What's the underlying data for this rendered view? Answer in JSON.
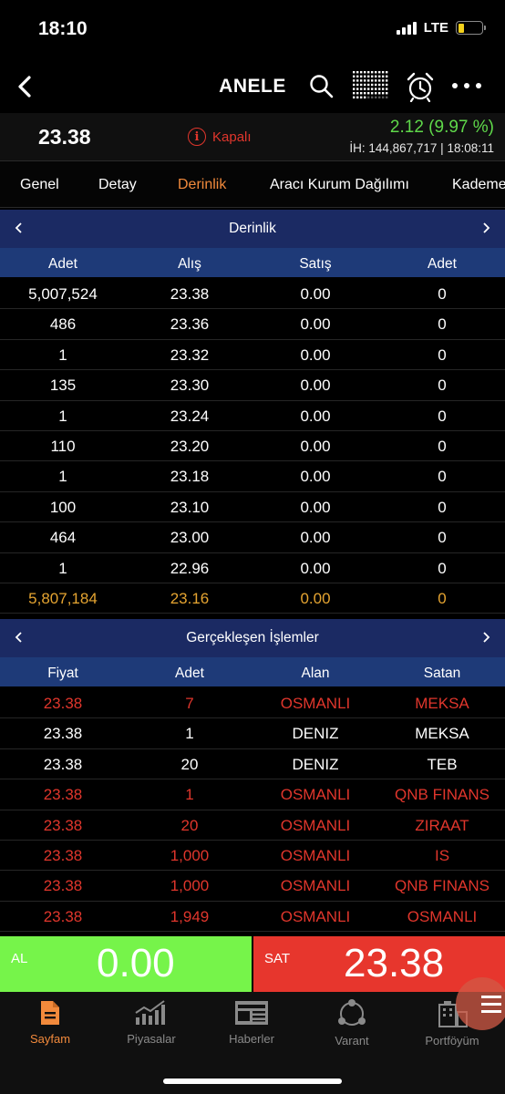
{
  "status": {
    "time": "18:10",
    "network": "LTE"
  },
  "nav": {
    "title": "ANELE"
  },
  "price": {
    "last": "23.38",
    "state": "Kapalı",
    "change": "2.12 (9.97 %)",
    "volume": "İH:  144,867,717 | 18:08:11"
  },
  "tabs": [
    {
      "label": "Genel"
    },
    {
      "label": "Detay"
    },
    {
      "label": "Derinlik"
    },
    {
      "label": "Aracı Kurum Dağılımı"
    },
    {
      "label": "Kademe"
    }
  ],
  "depth": {
    "title": "Derinlik",
    "columns": [
      "Adet",
      "Alış",
      "Satış",
      "Adet"
    ],
    "rows": [
      [
        "5,007,524",
        "23.38",
        "0.00",
        "0"
      ],
      [
        "486",
        "23.36",
        "0.00",
        "0"
      ],
      [
        "1",
        "23.32",
        "0.00",
        "0"
      ],
      [
        "135",
        "23.30",
        "0.00",
        "0"
      ],
      [
        "1",
        "23.24",
        "0.00",
        "0"
      ],
      [
        "110",
        "23.20",
        "0.00",
        "0"
      ],
      [
        "1",
        "23.18",
        "0.00",
        "0"
      ],
      [
        "100",
        "23.10",
        "0.00",
        "0"
      ],
      [
        "464",
        "23.00",
        "0.00",
        "0"
      ],
      [
        "1",
        "22.96",
        "0.00",
        "0"
      ]
    ],
    "total": [
      "5,807,184",
      "23.16",
      "0.00",
      "0"
    ]
  },
  "trades": {
    "title": "Gerçekleşen İşlemler",
    "columns": [
      "Fiyat",
      "Adet",
      "Alan",
      "Satan"
    ],
    "rows": [
      {
        "cells": [
          "23.38",
          "7",
          "OSMANLI",
          "MEKSA"
        ],
        "color": "red"
      },
      {
        "cells": [
          "23.38",
          "1",
          "DENIZ",
          "MEKSA"
        ],
        "color": "white"
      },
      {
        "cells": [
          "23.38",
          "20",
          "DENIZ",
          "TEB"
        ],
        "color": "white"
      },
      {
        "cells": [
          "23.38",
          "1",
          "OSMANLI",
          "QNB FINANS"
        ],
        "color": "red"
      },
      {
        "cells": [
          "23.38",
          "20",
          "OSMANLI",
          "ZIRAAT"
        ],
        "color": "red"
      },
      {
        "cells": [
          "23.38",
          "1,000",
          "OSMANLI",
          "IS"
        ],
        "color": "red"
      },
      {
        "cells": [
          "23.38",
          "1,000",
          "OSMANLI",
          "QNB FINANS"
        ],
        "color": "red"
      },
      {
        "cells": [
          "23.38",
          "1,949",
          "OSMANLI",
          "OSMANLI"
        ],
        "color": "red"
      }
    ]
  },
  "trade": {
    "buy_label": "AL",
    "buy_value": "0.00",
    "sell_label": "SAT",
    "sell_value": "23.38"
  },
  "tabbar": [
    {
      "label": "Sayfam",
      "icon": "document-icon"
    },
    {
      "label": "Piyasalar",
      "icon": "chart-icon"
    },
    {
      "label": "Haberler",
      "icon": "news-icon"
    },
    {
      "label": "Varant",
      "icon": "network-icon"
    },
    {
      "label": "Portföyüm",
      "icon": "building-icon"
    }
  ],
  "colors": {
    "accent": "#f28a3c",
    "up": "#5fd84a",
    "down": "#e0362c",
    "buy": "#76f44a",
    "sell": "#e7362d",
    "section": "#1b2a63",
    "column_header": "#1e3a78"
  }
}
